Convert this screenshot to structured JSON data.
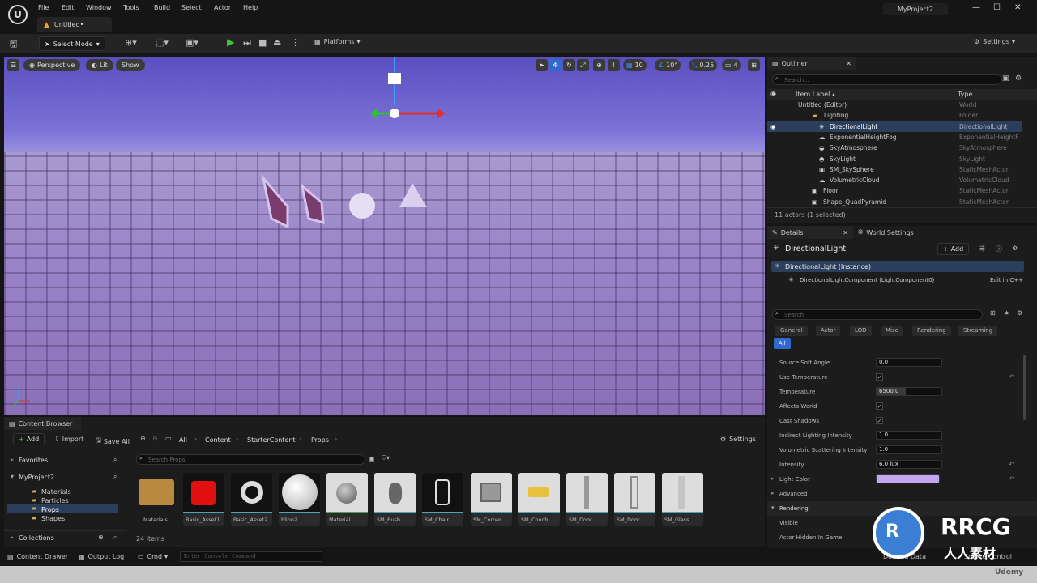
{
  "titlebar": {
    "menu": [
      "File",
      "Edit",
      "Window",
      "Tools",
      "Build",
      "Select",
      "Actor",
      "Help"
    ],
    "tab_label": "Untitled•",
    "project": "MyProject2"
  },
  "toolbar": {
    "select_mode": "Select Mode",
    "platforms": "Platforms",
    "settings": "Settings"
  },
  "viewport": {
    "perspective": "Perspective",
    "lit": "Lit",
    "show": "Show",
    "grid_snap": "10",
    "rot_snap": "10°",
    "scale_snap": "0.25",
    "cam_speed": "4"
  },
  "outliner": {
    "title": "Outliner",
    "search_placeholder": "Search...",
    "col_label": "Item Label ▴",
    "col_type": "Type",
    "rows": [
      {
        "label": "Untitled (Editor)",
        "type": "World"
      },
      {
        "label": "Lighting",
        "type": "Folder"
      },
      {
        "label": "DirectionalLight",
        "type": "DirectionalLight"
      },
      {
        "label": "ExponentialHeightFog",
        "type": "ExponentialHeightF"
      },
      {
        "label": "SkyAtmosphere",
        "type": "SkyAtmosphere"
      },
      {
        "label": "SkyLight",
        "type": "SkyLight"
      },
      {
        "label": "SM_SkySphere",
        "type": "StaticMeshActor"
      },
      {
        "label": "VolumetricCloud",
        "type": "VolumetricCloud"
      },
      {
        "label": "Floor",
        "type": "StaticMeshActor"
      },
      {
        "label": "Shape_QuadPyramid",
        "type": "StaticMeshActor"
      }
    ],
    "footer": "11 actors (1 selected)"
  },
  "details": {
    "tab_details": "Details",
    "tab_world": "World Settings",
    "actor_name": "DirectionalLight",
    "add": "Add",
    "instance": "DirectionalLight (Instance)",
    "component": "DirectionalLightComponent (LightComponent0)",
    "edit_cpp": "Edit in C++",
    "search_placeholder": "Search",
    "filters": [
      "General",
      "Actor",
      "LOD",
      "Misc",
      "Rendering",
      "Streaming"
    ],
    "filter_all": "All",
    "props": {
      "source_soft_angle": {
        "name": "Source Soft Angle",
        "value": "0.0"
      },
      "use_temperature": {
        "name": "Use Temperature"
      },
      "temperature": {
        "name": "Temperature",
        "value": "6500.0"
      },
      "affects_world": {
        "name": "Affects World"
      },
      "cast_shadows": {
        "name": "Cast Shadows"
      },
      "indirect": {
        "name": "Indirect Lighting Intensity",
        "value": "1.0"
      },
      "volumetric": {
        "name": "Volumetric Scattering Intensity",
        "value": "1.0"
      },
      "intensity": {
        "name": "Intensity",
        "value": "6.0 lux"
      },
      "light_color": {
        "name": "Light Color",
        "color": "#c3a6f0"
      },
      "advanced": {
        "name": "Advanced"
      },
      "rendering": {
        "name": "Rendering"
      },
      "visible": {
        "name": "Visible"
      },
      "hidden_in_game": {
        "name": "Actor Hidden In Game"
      }
    }
  },
  "content_browser": {
    "title": "Content Browser",
    "add": "Add",
    "import": "Import",
    "save_all": "Save All",
    "path": [
      "All",
      "Content",
      "StarterContent",
      "Props"
    ],
    "settings": "Settings",
    "favorites": "Favorites",
    "project": "MyProject2",
    "folders": [
      "Materials",
      "Particles",
      "Props",
      "Shapes"
    ],
    "collections": "Collections",
    "search_placeholder": "Search Props",
    "item_count": "24 items",
    "assets": [
      "Materials",
      "Basic_Asset1",
      "Basic_Asset2",
      "blinn2",
      "Material",
      "SM_Bush",
      "SM_Chair",
      "SM_Corner",
      "SM_Couch",
      "SM_Door",
      "SM_Door",
      "SM_Glass"
    ]
  },
  "statusbar": {
    "content_drawer": "Content Drawer",
    "output_log": "Output Log",
    "cmd": "Cmd",
    "console_placeholder": "Enter Console Command",
    "derived_data": "Derived Data",
    "source_control": "Source Control"
  },
  "watermark": {
    "brand": "RRCG",
    "sub": "人人素材",
    "udemy": "Udemy"
  }
}
